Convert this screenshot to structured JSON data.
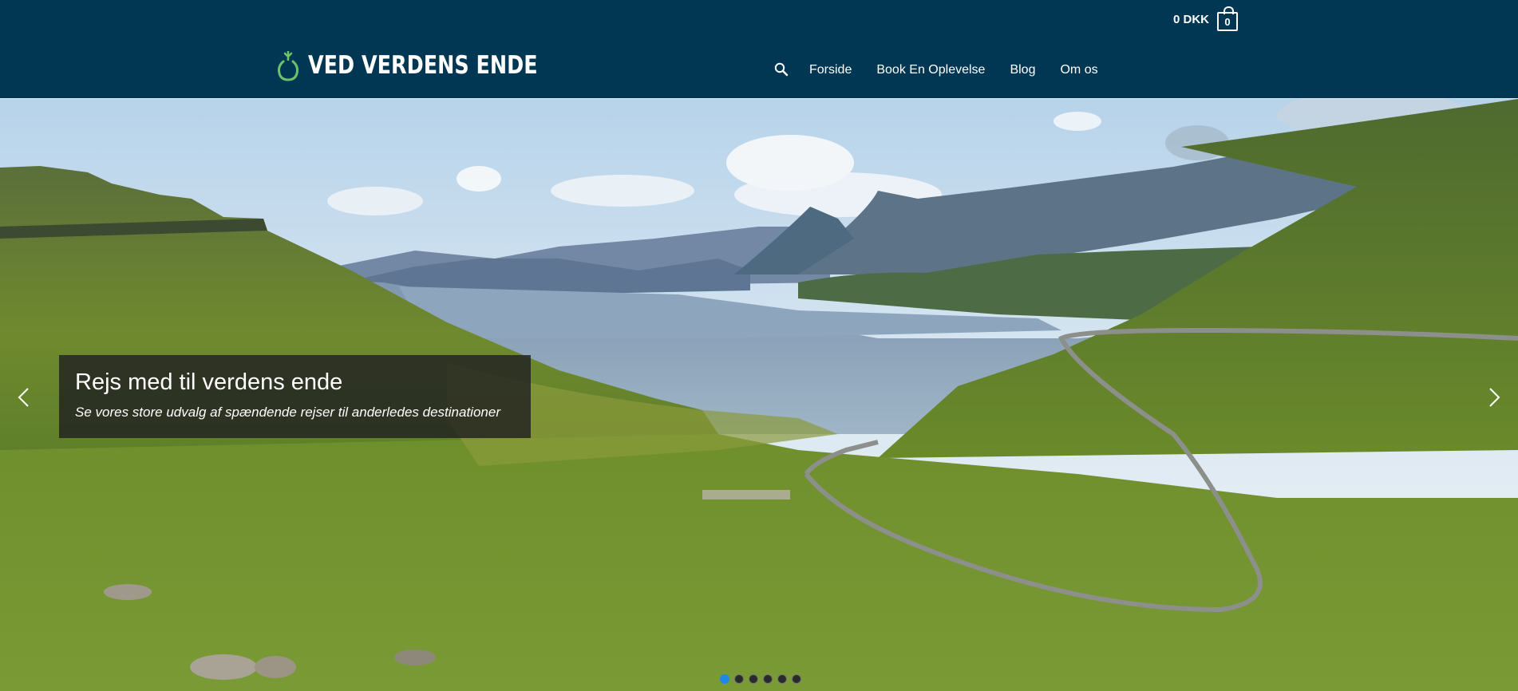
{
  "header": {
    "cart": {
      "amount": "0 DKK",
      "count": "0"
    },
    "brand": {
      "name": "VED VERDENS ENDE"
    },
    "nav": {
      "search_icon": "search-icon",
      "items": [
        {
          "label": "Forside"
        },
        {
          "label": "Book En Oplevelse"
        },
        {
          "label": "Blog"
        },
        {
          "label": "Om os"
        }
      ]
    }
  },
  "hero": {
    "title": "Rejs med til verdens ende",
    "subtitle": "Se vores store udvalg af spændende rejser til anderledes destinationer",
    "slide_count": 6,
    "active_slide": 1,
    "prev_icon": "chevron-left-icon",
    "next_icon": "chevron-right-icon"
  },
  "colors": {
    "header_bg": "#023754",
    "logo_green": "#6cc26b",
    "dot_active": "#1e88e5",
    "caption_bg": "rgba(33,33,33,0.82)"
  }
}
